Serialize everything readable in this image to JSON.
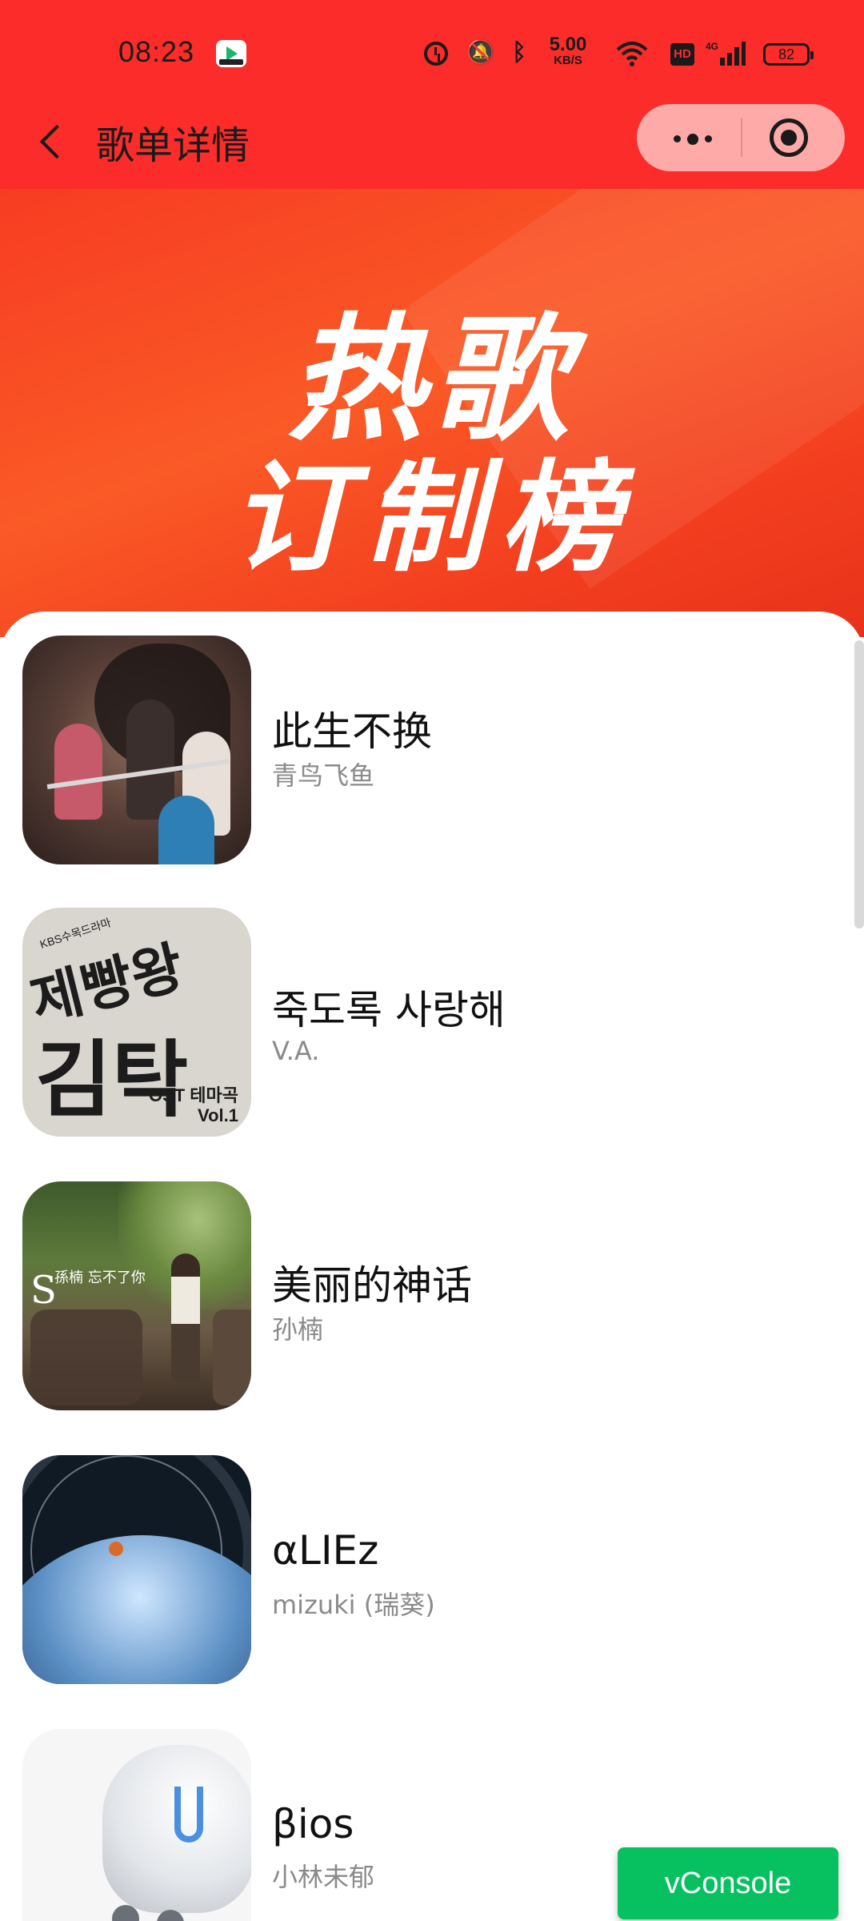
{
  "status_bar": {
    "time": "08:23",
    "network_speed_value": "5.00",
    "network_speed_unit": "KB/S",
    "hd_label": "HD",
    "network_type": "4G",
    "battery": "82",
    "icons": [
      "video-app-icon",
      "alarm-icon",
      "mute-icon",
      "bluetooth-icon",
      "wifi-icon",
      "hd-icon",
      "signal-icon",
      "battery-icon"
    ]
  },
  "nav": {
    "title": "歌单详情",
    "back_icon": "chevron-left-icon",
    "capsule_icons": [
      "more-dots-icon",
      "target-icon"
    ]
  },
  "banner": {
    "line1": "热歌",
    "line2": "订制榜"
  },
  "songs": [
    {
      "title": "此生不换",
      "artist": "青鸟飞鱼"
    },
    {
      "title": "죽도록 사랑해",
      "artist": "V.A.",
      "cover_text": {
        "top": "KBS수목드라마",
        "big1": "제빵왕",
        "big2": "김탁구",
        "ost": "OST 테마곡",
        "vol": "Vol.1"
      }
    },
    {
      "title": "美丽的神话",
      "artist": "孙楠",
      "cover_text": {
        "logo": "S",
        "title": "孫楠 忘不了你"
      }
    },
    {
      "title": "αLIEz",
      "artist": "mizuki (瑞葵)"
    },
    {
      "title": "βios",
      "artist": "小林未郁"
    }
  ],
  "vconsole": {
    "label": "vConsole"
  },
  "colors": {
    "header": "#fb2c2a",
    "vconsole": "#07c160"
  }
}
